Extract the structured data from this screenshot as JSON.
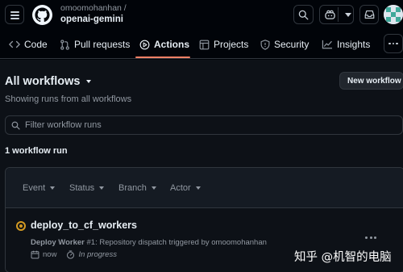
{
  "header": {
    "owner": "omoomohanhan /",
    "repo": "openai-gemini"
  },
  "nav": {
    "tabs": [
      {
        "label": "Code",
        "icon": "code-icon"
      },
      {
        "label": "Pull requests",
        "icon": "pull-request-icon"
      },
      {
        "label": "Actions",
        "icon": "play-icon",
        "active": true
      },
      {
        "label": "Projects",
        "icon": "table-icon"
      },
      {
        "label": "Security",
        "icon": "shield-icon"
      },
      {
        "label": "Insights",
        "icon": "graph-icon"
      }
    ]
  },
  "main": {
    "title": "All workflows",
    "subtitle": "Showing runs from all workflows",
    "new_workflow_label": "New workflow",
    "filter_placeholder": "Filter workflow runs",
    "run_count": "1 workflow run",
    "filters": [
      "Event",
      "Status",
      "Branch",
      "Actor"
    ],
    "run": {
      "name": "deploy_to_cf_workers",
      "workflow": "Deploy Worker",
      "number": "#1",
      "description": ": Repository dispatch triggered by omoomohanhan",
      "time": "now",
      "status": "In progress",
      "status_color": "#d29922"
    }
  },
  "watermark": "知乎 @机智的电脑",
  "colors": {
    "accent_underline": "#f78166",
    "background": "#0d1117",
    "header_background": "#010409",
    "border": "#30363d",
    "text": "#e6edf3",
    "muted_text": "#9198a1"
  }
}
